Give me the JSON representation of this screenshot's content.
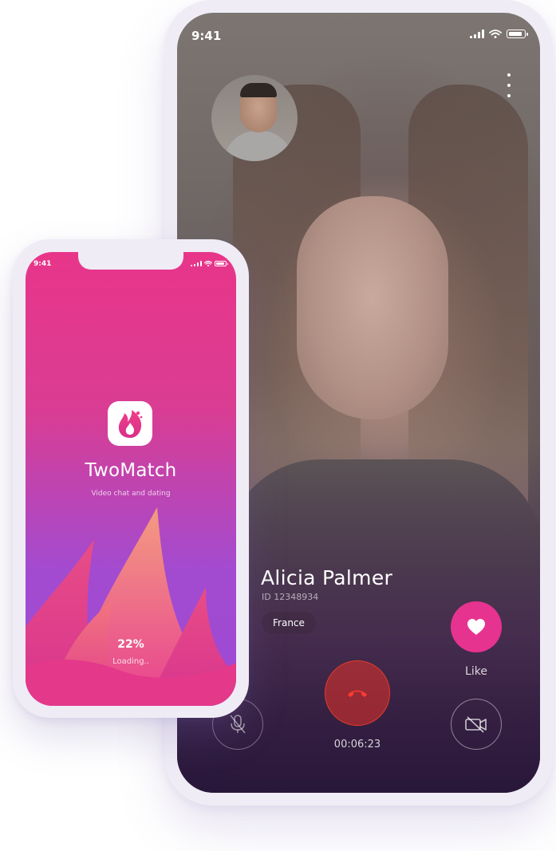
{
  "video_call": {
    "status_bar": {
      "time": "9:41"
    },
    "caller": {
      "name": "Alicia Palmer",
      "id_text": "ID 12348934",
      "country": "France"
    },
    "controls": {
      "like_label": "Like",
      "timer": "00:06:23"
    },
    "icons": [
      "menu-dots-icon",
      "heart-icon",
      "end-call-icon",
      "camera-off-icon",
      "mic-off-icon"
    ],
    "colors": {
      "like": "#e6338f",
      "end_call": "#e33b2b"
    }
  },
  "splash": {
    "status_bar": {
      "time": "9:41"
    },
    "app_name": "TwoMatch",
    "tagline": "Video chat and dating",
    "progress": {
      "percent_text": "22%",
      "value": 0.22,
      "label": "Loading.."
    },
    "colors": {
      "gradient_top": "#e8358a",
      "gradient_bottom": "#9c4ad6"
    }
  }
}
